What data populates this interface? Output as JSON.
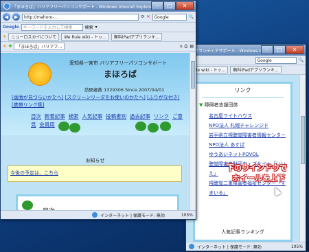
{
  "back_window": {
    "title": "ボランティアサポート - Windows Internet Explorer",
    "tabs": [
      "Rule wiki - トッ...",
      "無料iPadアプリランキ..."
    ],
    "search_placeholder": "Google",
    "heading": "リンク",
    "section": "障碍者支援団体",
    "links": [
      "名古屋ライトハウス",
      "NPO法人 札幌チャレンジド",
      "岩手県立視聴覚障害者情報センター",
      "NPO法人 あすば",
      "ゆうあいネットPOVOL",
      "聴覚障害者財団ウェブサイト「いいえ」",
      "視聴覚二重障害者福祉センター「すまいる」"
    ],
    "bottom_text": "人気記事ランキング",
    "status_text": "インターネット | 保護モード: 無効",
    "zoom": "105%"
  },
  "front_window": {
    "title": "「まほろば」バリアフリーパソコンサポート - Windows Internet Explorer",
    "address": "http://mahoro-...",
    "search_engine": "Google",
    "google_placeholder": "キーワードを入力して検索",
    "favorites": [
      "ニューロスカイについて",
      "We Rule wiki - トッ...",
      "無料iPadアプリランキ..."
    ],
    "tab": "「まほろば」バリアフ...",
    "site_subtitle": "愛知県一宮市 バリアフリーパソコンサポート",
    "site_title": "まほろば",
    "counter": "訪問者数 1329306  Since 2007/04/01",
    "access_links": [
      "[画面が見づらいかたへ]",
      "[スクリーンリーダをお使いのかたへ]",
      "[ふりがな付き]",
      "[携帯リンク集]"
    ],
    "nav_links": [
      "目次",
      "新着記事",
      "検索",
      "人気記事",
      "投稿者別",
      "過去記事",
      "リンク",
      "ご意見",
      "会員用"
    ],
    "notice_title": "お知らせ",
    "notice_link": "今後の予定は、こちら",
    "toc": "目次",
    "status_text": "インターネット | 保護モード: 無効",
    "zoom": "105%"
  },
  "callout": [
    "下のウインドウで",
    "ホイールを上下"
  ]
}
